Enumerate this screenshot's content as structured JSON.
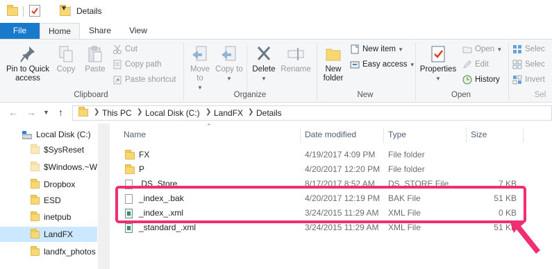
{
  "window": {
    "title": "Details"
  },
  "tabs": {
    "file": "File",
    "home": "Home",
    "share": "Share",
    "view": "View"
  },
  "ribbon": {
    "clipboard": {
      "label": "Clipboard",
      "pin": "Pin to Quick access",
      "copy": "Copy",
      "paste": "Paste",
      "cut": "Cut",
      "copy_path": "Copy path",
      "paste_shortcut": "Paste shortcut"
    },
    "organize": {
      "label": "Organize",
      "move_to": "Move to",
      "copy_to": "Copy to",
      "delete": "Delete",
      "rename": "Rename"
    },
    "new": {
      "label": "New",
      "new_folder": "New folder",
      "new_item": "New item",
      "easy_access": "Easy access"
    },
    "open": {
      "label": "Open",
      "properties": "Properties",
      "open": "Open",
      "edit": "Edit",
      "history": "History"
    },
    "select": {
      "label": "Sel",
      "select_all": "Selec",
      "select_none": "Selec",
      "invert": "Invert"
    }
  },
  "address": {
    "crumbs": [
      "This PC",
      "Local Disk (C:)",
      "LandFX",
      "Details"
    ]
  },
  "nav": {
    "items": [
      "Local Disk (C:)",
      "$SysReset",
      "$Windows.~W",
      "Dropbox",
      "ESD",
      "inetpub",
      "LandFX",
      "landfx_photos"
    ],
    "selected": "LandFX"
  },
  "columns": {
    "name": "Name",
    "date": "Date modified",
    "type": "Type",
    "size": "Size"
  },
  "files": [
    {
      "name": "FX",
      "date": "4/19/2017 4:09 PM",
      "type": "File folder",
      "size": "",
      "icon": "folder-icon"
    },
    {
      "name": "P",
      "date": "4/20/2017 12:20 PM",
      "type": "File folder",
      "size": "",
      "icon": "folder-icon"
    },
    {
      "name": ".DS_Store",
      "date": "8/17/2017 8:52 AM",
      "type": "DS_STORE File",
      "size": "7 KB",
      "icon": "file-icon"
    },
    {
      "name": "_index_.bak",
      "date": "4/20/2017 12:19 PM",
      "type": "BAK File",
      "size": "51 KB",
      "icon": "file-icon"
    },
    {
      "name": "_index_.xml",
      "date": "3/24/2015 11:29 AM",
      "type": "XML File",
      "size": "0 KB",
      "icon": "xml-file-icon"
    },
    {
      "name": "_standard_.xml",
      "date": "3/24/2015 11:29 AM",
      "type": "XML File",
      "size": "51 KB",
      "icon": "xml-file-icon"
    }
  ],
  "colors": {
    "accent": "#1979ca",
    "highlight": "#ef2f72",
    "selection": "#cce8ff"
  }
}
